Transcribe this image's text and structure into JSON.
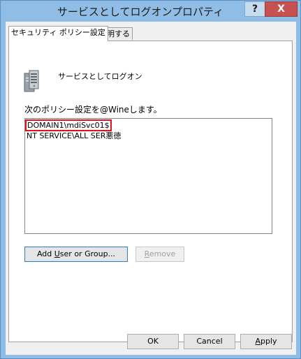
{
  "window": {
    "title": "サービスとしてログオンプロパティ",
    "help_glyph": "?",
    "close_glyph": "X"
  },
  "tabs": [
    {
      "label": "セキュリティ ポリシー設定",
      "active": true
    },
    {
      "label": "説明する",
      "active": false
    }
  ],
  "policy": {
    "icon": "server-icon",
    "name": "サービスとしてログオン",
    "caption": "次のポリシー設定を@Wineします。"
  },
  "accounts": [
    {
      "name": "DOMAIN1\\mdiSvc01$",
      "selected": true
    },
    {
      "name": "NT SERVICE\\ALL SER悪徳",
      "selected": false
    }
  ],
  "actions": {
    "add_label_pre": "Add ",
    "add_label_mn": "U",
    "add_label_post": "ser or Group...",
    "remove_label_mn": "R",
    "remove_label_post": "emove"
  },
  "footer": {
    "ok_label": "OK",
    "cancel_label": "Cancel",
    "apply_label_mn": "A",
    "apply_label_post": "pply"
  },
  "colors": {
    "title_bar": "#8fbde6",
    "close_button": "#c75050",
    "selection_outline": "#e0111b"
  }
}
